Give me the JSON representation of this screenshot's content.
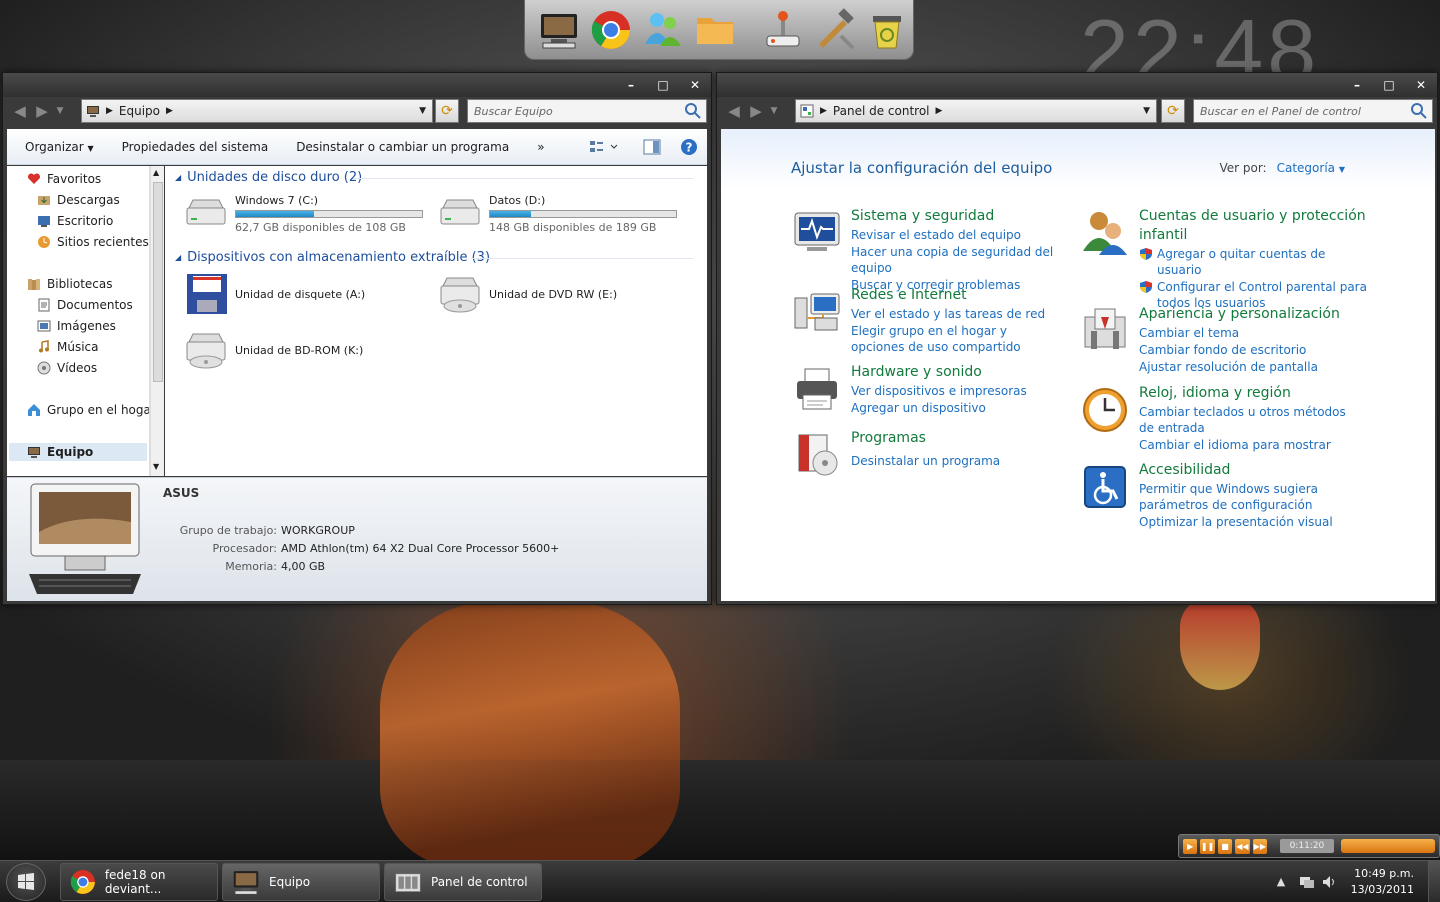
{
  "desktop": {
    "clock": "22:48"
  },
  "dock": {
    "items": [
      "computer-icon",
      "chrome-icon",
      "messenger-icon",
      "folder-icon",
      "joystick-icon",
      "tools-icon",
      "recycle-bin-icon"
    ]
  },
  "equipo_window": {
    "address": {
      "crumb": "Equipo",
      "search_placeholder": "Buscar Equipo"
    },
    "toolbar": {
      "organize": "Organizar",
      "properties": "Propiedades del sistema",
      "uninstall": "Desinstalar o cambiar un programa",
      "more": "»"
    },
    "nav": {
      "favorites": "Favoritos",
      "downloads": "Descargas",
      "desktop": "Escritorio",
      "recent": "Sitios recientes",
      "libraries": "Bibliotecas",
      "documents": "Documentos",
      "images": "Imágenes",
      "music": "Música",
      "videos": "Vídeos",
      "homegroup": "Grupo en el hogar",
      "computer": "Equipo"
    },
    "groups": {
      "hdd": "Unidades de disco duro (2)",
      "removable": "Dispositivos con almacenamiento extraíble (3)"
    },
    "drives": [
      {
        "name": "Windows 7 (C:)",
        "free": "62,7 GB disponibles de 108 GB",
        "used_fraction": 0.42
      },
      {
        "name": "Datos (D:)",
        "free": "148 GB disponibles de 189 GB",
        "used_fraction": 0.22
      }
    ],
    "removable": [
      {
        "name": "Unidad de disquete (A:)"
      },
      {
        "name": "Unidad de DVD RW (E:)"
      },
      {
        "name": "Unidad de BD-ROM (K:)"
      }
    ],
    "details": {
      "computer_name": "ASUS",
      "workgroup_label": "Grupo de trabajo:",
      "workgroup_value": "WORKGROUP",
      "cpu_label": "Procesador:",
      "cpu_value": "AMD Athlon(tm) 64 X2 Dual Core Processor 5600+",
      "memory_label": "Memoria:",
      "memory_value": "4,00 GB"
    }
  },
  "panel_window": {
    "address": {
      "crumb": "Panel de control",
      "search_placeholder": "Buscar en el Panel de control"
    },
    "title": "Ajustar la configuración del equipo",
    "view_by_label": "Ver por:",
    "view_by_value": "Categoría",
    "categories_left": [
      {
        "title": "Sistema y seguridad",
        "links": [
          "Revisar el estado del equipo",
          "Hacer una copia de seguridad del equipo",
          "Buscar y corregir problemas"
        ]
      },
      {
        "title": "Redes e Internet",
        "links": [
          "Ver el estado y las tareas de red",
          "Elegir grupo en el hogar y opciones de uso compartido"
        ]
      },
      {
        "title": "Hardware y sonido",
        "links": [
          "Ver dispositivos e impresoras",
          "Agregar un dispositivo"
        ]
      },
      {
        "title": "Programas",
        "links": [
          "Desinstalar un programa"
        ]
      }
    ],
    "categories_right": [
      {
        "title": "Cuentas de usuario y protección infantil",
        "links": [
          "Agregar o quitar cuentas de usuario",
          "Configurar el Control parental para todos los usuarios"
        ]
      },
      {
        "title": "Apariencia y personalización",
        "links": [
          "Cambiar el tema",
          "Cambiar fondo de escritorio",
          "Ajustar resolución de pantalla"
        ]
      },
      {
        "title": "Reloj, idioma y región",
        "links": [
          "Cambiar teclados u otros métodos de entrada",
          "Cambiar el idioma para mostrar"
        ]
      },
      {
        "title": "Accesibilidad",
        "links": [
          "Permitir que Windows sugiera parámetros de configuración",
          "Optimizar la presentación visual"
        ]
      }
    ]
  },
  "media_player": {
    "time": "0:11:20"
  },
  "taskbar": {
    "tasks": [
      {
        "label": "fede18 on deviant..."
      },
      {
        "label": "Equipo"
      },
      {
        "label": "Panel de control"
      }
    ],
    "time": "10:49 p.m.",
    "date": "13/03/2011"
  }
}
